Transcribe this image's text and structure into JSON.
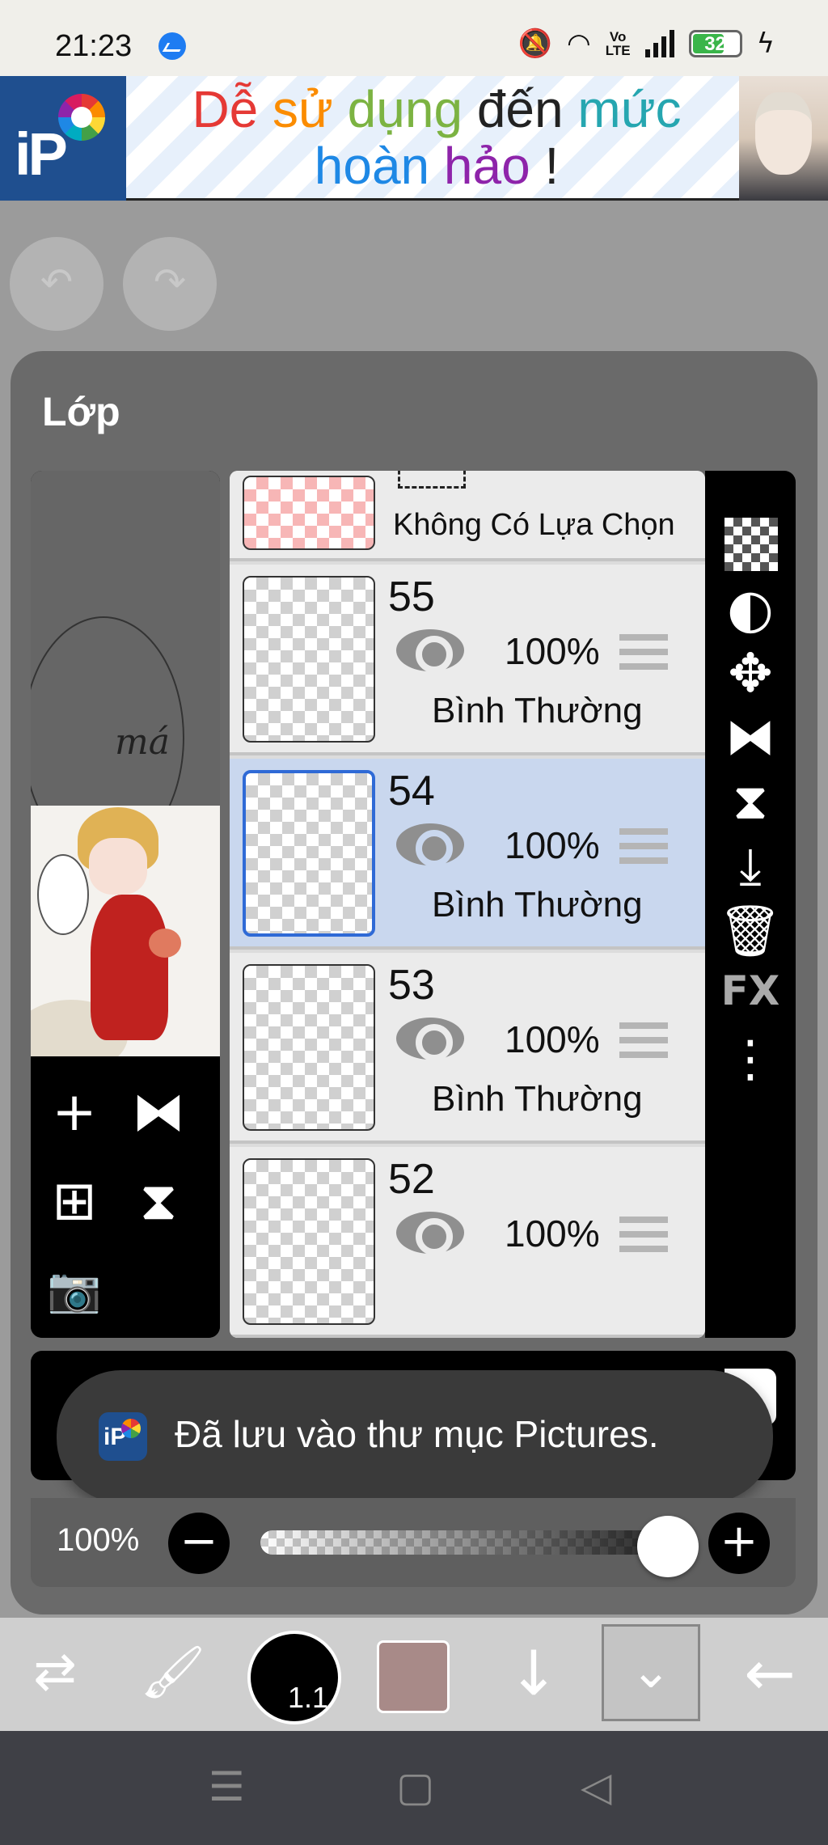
{
  "status": {
    "time": "21:23",
    "battery": "32",
    "volte_top": "Vo",
    "volte_bottom": "LTE"
  },
  "ad": {
    "line1_words": [
      "Dễ",
      "sử",
      "dụng",
      "đến",
      "mức"
    ],
    "line2_words": [
      "hoàn",
      "hảo",
      "!"
    ],
    "colors": {
      "w1": "#e53935",
      "w2": "#fb8c00",
      "w3": "#7cb342",
      "w4": "#222222",
      "w5": "#26a6b0",
      "w6": "#1e88e5",
      "w7": "#8e24aa",
      "w8": "#222222"
    }
  },
  "panel": {
    "title": "Lớp",
    "preview_sketch_text": "má"
  },
  "layers": [
    {
      "kind": "selection",
      "label": "Không Có Lựa Chọn"
    },
    {
      "number": "55",
      "opacity": "100%",
      "blend": "Bình Thường",
      "selected": false
    },
    {
      "number": "54",
      "opacity": "100%",
      "blend": "Bình Thường",
      "selected": true
    },
    {
      "number": "53",
      "opacity": "100%",
      "blend": "Bình Thường",
      "selected": false
    },
    {
      "number": "52",
      "opacity": "100%",
      "blend": "",
      "selected": false
    }
  ],
  "right_tools": {
    "fx_label": "FX"
  },
  "toast": {
    "message": "Đã lưu vào thư mục Pictures."
  },
  "opacity_slider": {
    "label": "100%",
    "value": 1.0
  },
  "toolbar": {
    "brush_size": "1.1",
    "color": "#a88a88"
  }
}
